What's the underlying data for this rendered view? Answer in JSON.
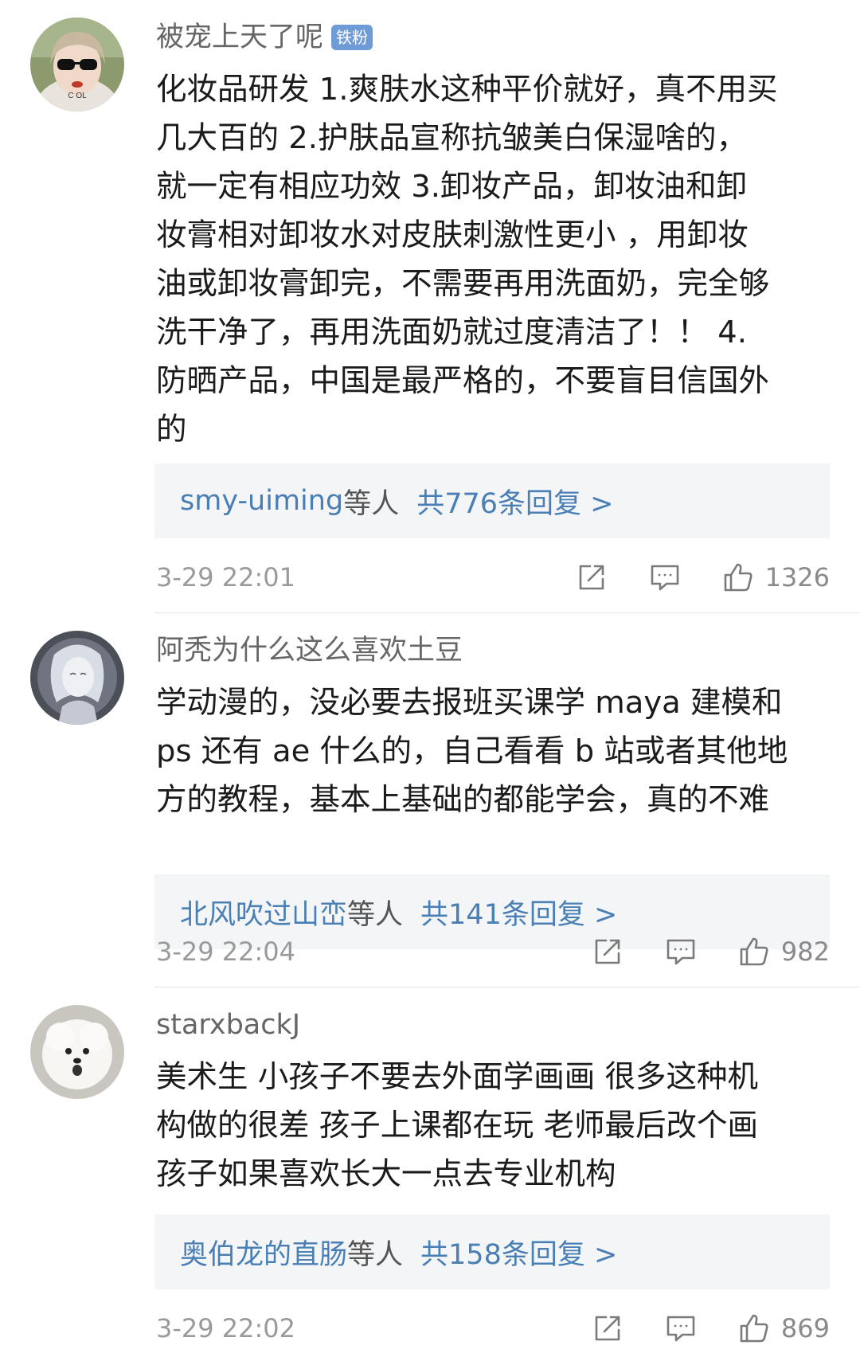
{
  "comments": [
    {
      "username": "被宠上天了呢",
      "badge": "铁粉",
      "text": "化妆品研发 1.爽肤水这种平价就好，真不用买\n几大百的 2.护肤品宣称抗皱美白保湿啥的，\n就一定有相应功效 3.卸妆产品，卸妆油和卸\n妆膏相对卸妆水对皮肤刺激性更小 ，用卸妆\n油或卸妆膏卸完，不需要再用洗面奶，完全够\n洗干净了，再用洗面奶就过度清洁了！！ 4.\n防晒产品，中国是最严格的，不要盲目信国外\n的",
      "reply_users": "smy-uiming",
      "reply_suffix": "等人",
      "reply_count": "共776条回复 >",
      "timestamp": "3-29 22:01",
      "likes": "1326"
    },
    {
      "username": "阿秃为什么这么喜欢土豆",
      "badge": "",
      "text": "学动漫的，没必要去报班买课学 maya 建模和\nps 还有 ae 什么的，自己看看 b 站或者其他地\n方的教程，基本上基础的都能学会，真的不难",
      "reply_users": "北风吹过山峦",
      "reply_suffix": "等人",
      "reply_count": "共141条回复 >",
      "timestamp": "3-29 22:04",
      "likes": "982"
    },
    {
      "username": "starxbackJ",
      "badge": "",
      "text": "美术生 小孩子不要去外面学画画 很多这种机\n构做的很差 孩子上课都在玩 老师最后改个画\n孩子如果喜欢长大一点去专业机构",
      "reply_users": "奥伯龙的直肠",
      "reply_suffix": "等人",
      "reply_count": "共158条回复 >",
      "timestamp": "3-29 22:02",
      "likes": "869"
    }
  ],
  "avatars": {
    "c1_text": "C  OL"
  },
  "colors": {
    "link_blue": "#4a7fb5",
    "badge_blue": "#6f9bd6",
    "reply_bg": "#f4f5f7",
    "meta_gray": "#9a9a9a"
  },
  "icons": {
    "share": "share-icon",
    "comment": "comment-icon",
    "like": "thumbs-up-icon"
  }
}
